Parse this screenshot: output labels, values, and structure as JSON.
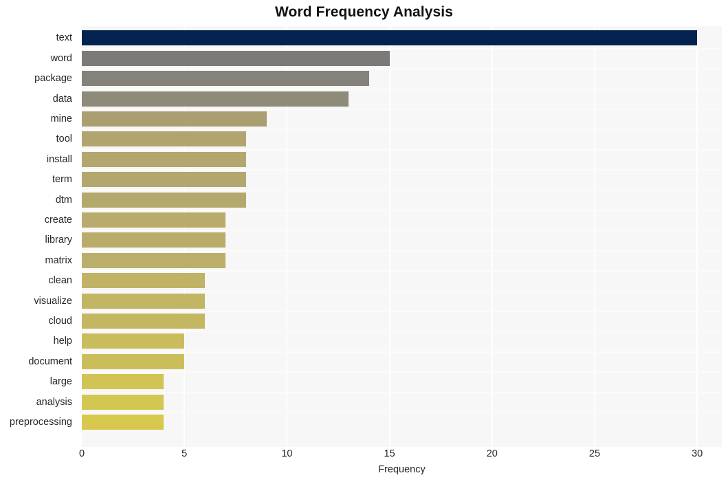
{
  "chart_data": {
    "type": "bar",
    "orientation": "horizontal",
    "title": "Word Frequency Analysis",
    "xlabel": "Frequency",
    "ylabel": "",
    "xlim": [
      0,
      31.2
    ],
    "ylim": [
      0,
      20
    ],
    "grid": true,
    "legend": null,
    "x_ticks": [
      0,
      5,
      10,
      15,
      20,
      25,
      30
    ],
    "x_tick_labels": [
      "0",
      "5",
      "10",
      "15",
      "20",
      "25",
      "30"
    ],
    "categories": [
      "text",
      "word",
      "package",
      "data",
      "mine",
      "tool",
      "install",
      "term",
      "dtm",
      "create",
      "library",
      "matrix",
      "clean",
      "visualize",
      "cloud",
      "help",
      "document",
      "large",
      "analysis",
      "preprocessing"
    ],
    "values": [
      30,
      15,
      14,
      13,
      9,
      8,
      8,
      8,
      8,
      7,
      7,
      7,
      6,
      6,
      6,
      5,
      5,
      4,
      4,
      4
    ],
    "bar_colors": [
      "#032250",
      "#7b7a78",
      "#84827b",
      "#8f8b79",
      "#ab9f71",
      "#b1a46f",
      "#b3a66e",
      "#b4a76e",
      "#b5a86d",
      "#b8ab6c",
      "#b9ac6b",
      "#bbae6a",
      "#c0b365",
      "#c2b563",
      "#c4b761",
      "#c9bc5c",
      "#cbbe5a",
      "#d1c454",
      "#d4c751",
      "#d8c94e"
    ],
    "plot_background": "#f7f7f7",
    "gridline_color": "#ffffff",
    "figure_background": "#ffffff",
    "text_color": "#262626",
    "title_color": "#111111"
  }
}
